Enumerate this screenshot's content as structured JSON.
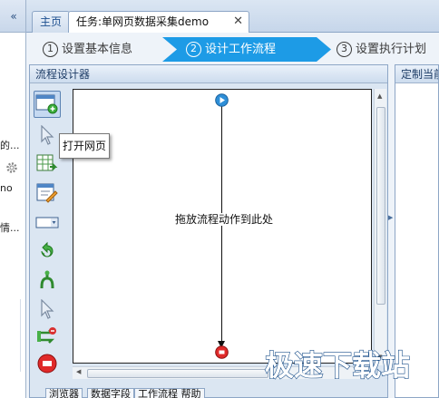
{
  "sidebar": {
    "collapse_label": "«",
    "items": [
      "的...",
      "no",
      "情..."
    ]
  },
  "tabs": {
    "home": "主页",
    "task": "任务:单网页数据采集demo",
    "close": "✕"
  },
  "steps": [
    {
      "num": "1",
      "label": "设置基本信息",
      "state": "done"
    },
    {
      "num": "2",
      "label": "设计工作流程",
      "state": "active"
    },
    {
      "num": "3",
      "label": "设置执行计划",
      "state": "pending"
    }
  ],
  "designer": {
    "title": "流程设计器",
    "drop_hint": "拖放流程动作到此处",
    "tooltip": "打开网页",
    "tools": [
      "open-webpage-icon",
      "click-element-icon",
      "extract-data-icon",
      "input-text-icon",
      "select-dropdown-icon",
      "loop-icon",
      "if-condition-icon",
      "mouse-hover-icon",
      "switch-dropdown-icon",
      "end-process-icon"
    ]
  },
  "right_panel": {
    "title": "定制当前"
  },
  "bottom_tabs": [
    "浏览器",
    "数据字段",
    "工作流程 帮助"
  ],
  "watermark": "极速下载站",
  "colors": {
    "accent": "#1d9be6",
    "panel_border": "#8da6c6",
    "background": "#cfdcec"
  }
}
